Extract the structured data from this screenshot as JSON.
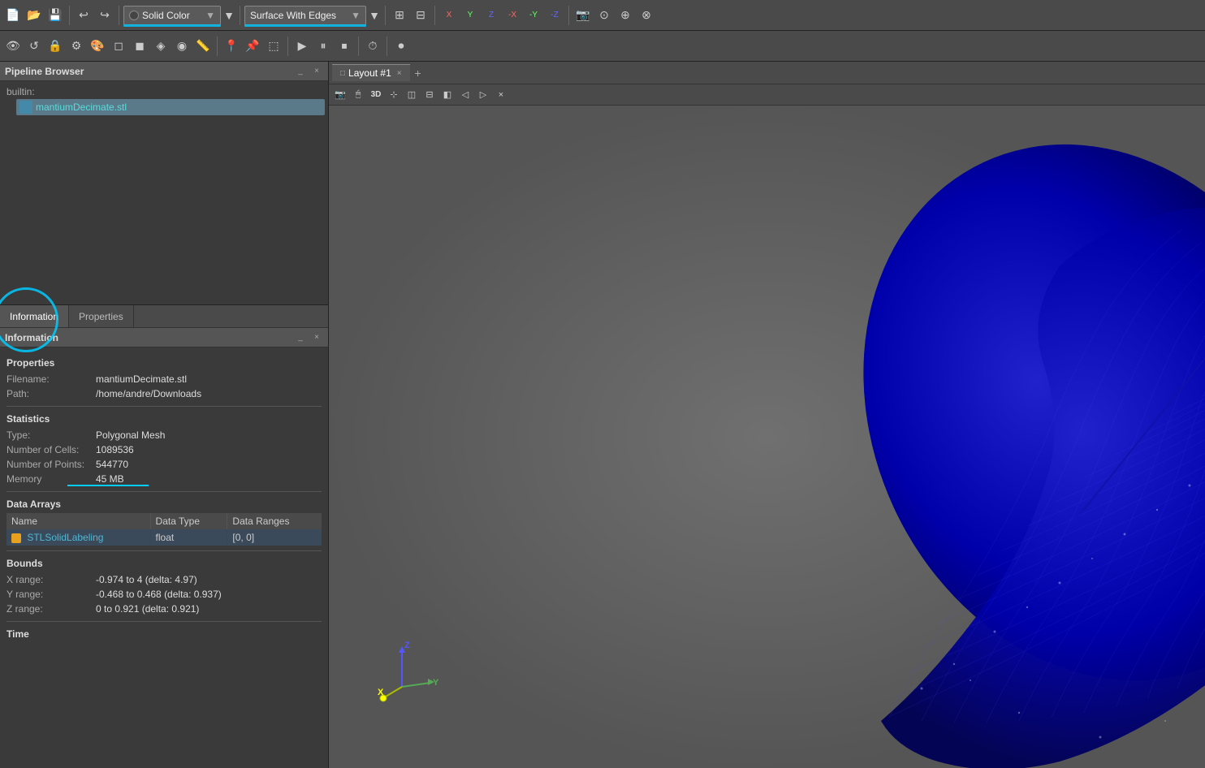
{
  "toolbar": {
    "color_label": "Solid Color",
    "render_label": "Surface With Edges",
    "icons_top": [
      "file-new",
      "file-open",
      "save",
      "undo",
      "redo",
      "camera",
      "separator1",
      "add-source",
      "separator2",
      "recenter",
      "zoom-in",
      "zoom-out"
    ],
    "icons_second": [
      "eye",
      "reset",
      "lock",
      "separator1",
      "play-fwd",
      "play-back",
      "step-fwd",
      "step-back",
      "loop",
      "separator2",
      "clock",
      "separator3",
      "record"
    ]
  },
  "pipeline_browser": {
    "title": "Pipeline Browser",
    "builtin_label": "builtin:",
    "file_item": "mantiumDecimate.stl"
  },
  "info_panel": {
    "title": "Information",
    "tab_information": "Information",
    "tab_properties": "Properties",
    "sections": {
      "properties": {
        "title": "Properties",
        "filename_label": "Filename:",
        "filename_value": "mantiumDecimate.stl",
        "path_label": "Path:",
        "path_value": "/home/andre/Downloads"
      },
      "statistics": {
        "title": "Statistics",
        "type_label": "Type:",
        "type_value": "Polygonal Mesh",
        "cells_label": "Number of Cells:",
        "cells_value": "1089536",
        "points_label": "Number of Points:",
        "points_value": "544770",
        "memory_label": "Memory",
        "memory_value": "45 MB"
      },
      "data_arrays": {
        "title": "Data Arrays",
        "columns": [
          "Name",
          "Data Type",
          "Data Ranges"
        ],
        "rows": [
          {
            "name": "STLSolidLabeling",
            "data_type": "float",
            "data_ranges": "[0, 0]"
          }
        ]
      },
      "bounds": {
        "title": "Bounds",
        "x_label": "X range:",
        "x_value": "-0.974 to 4 (delta: 4.97)",
        "y_label": "Y range:",
        "y_value": "-0.468 to 0.468 (delta: 0.937)",
        "z_label": "Z range:",
        "z_value": "0 to 0.921 (delta: 0.921)"
      },
      "time": {
        "title": "Time"
      }
    }
  },
  "viewport": {
    "tab_label": "Layout #1",
    "tab_close": "×",
    "add_tab": "+",
    "axis": {
      "x_label": "X",
      "y_label": "Y",
      "z_label": "Z"
    }
  }
}
